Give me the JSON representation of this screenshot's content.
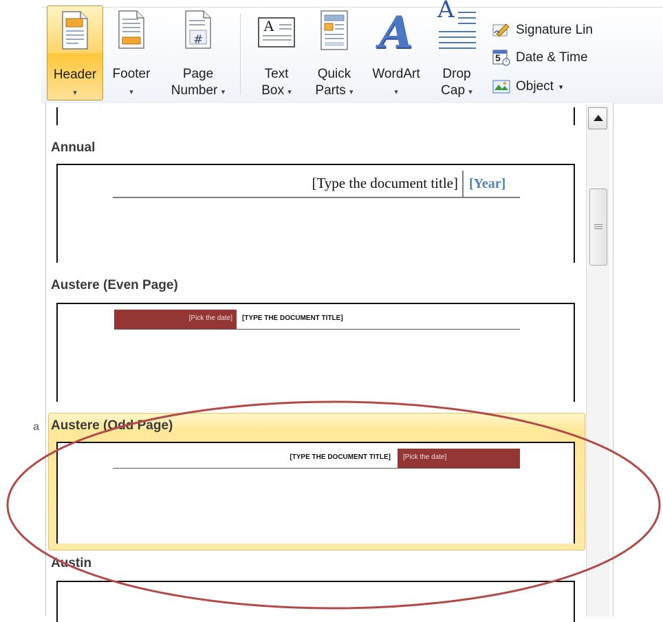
{
  "ribbon": {
    "header_label": "Header",
    "footer_label": "Footer",
    "page_number_line1": "Page",
    "page_number_line2": "Number",
    "text_box_line1": "Text",
    "text_box_line2": "Box",
    "quick_parts_line1": "Quick",
    "quick_parts_line2": "Parts",
    "wordart_label": "WordArt",
    "drop_cap_line1": "Drop",
    "drop_cap_line2": "Cap",
    "signature_line_label": "Signature Lin",
    "date_time_label": "Date & Time",
    "object_label": "Object",
    "dropdown_arrow": "▾",
    "page_number_glyph": "#",
    "text_box_glyph": "A",
    "wordart_glyph": "A",
    "drop_cap_glyph": "A",
    "date_time_glyph": "5"
  },
  "gallery": {
    "items": [
      {
        "title": "Annual",
        "doc_title": "[Type the document title]",
        "year": "[Year]"
      },
      {
        "title": "Austere (Even Page)",
        "date_placeholder": "[Pick the date]",
        "doc_title": "[TYPE THE DOCUMENT TITLE]"
      },
      {
        "title": "Austere (Odd Page)",
        "doc_title": "[TYPE THE DOCUMENT TITLE]",
        "date_placeholder": "[Pick the date]",
        "selected": true
      },
      {
        "title": "Austin"
      }
    ]
  },
  "colors": {
    "selection_fill": "#ffe89a",
    "austere_red": "#943634",
    "annual_year_blue": "#4f81bd",
    "annotation_ellipse": "#b24a48"
  },
  "left_edge_fragments": [
    "a"
  ]
}
